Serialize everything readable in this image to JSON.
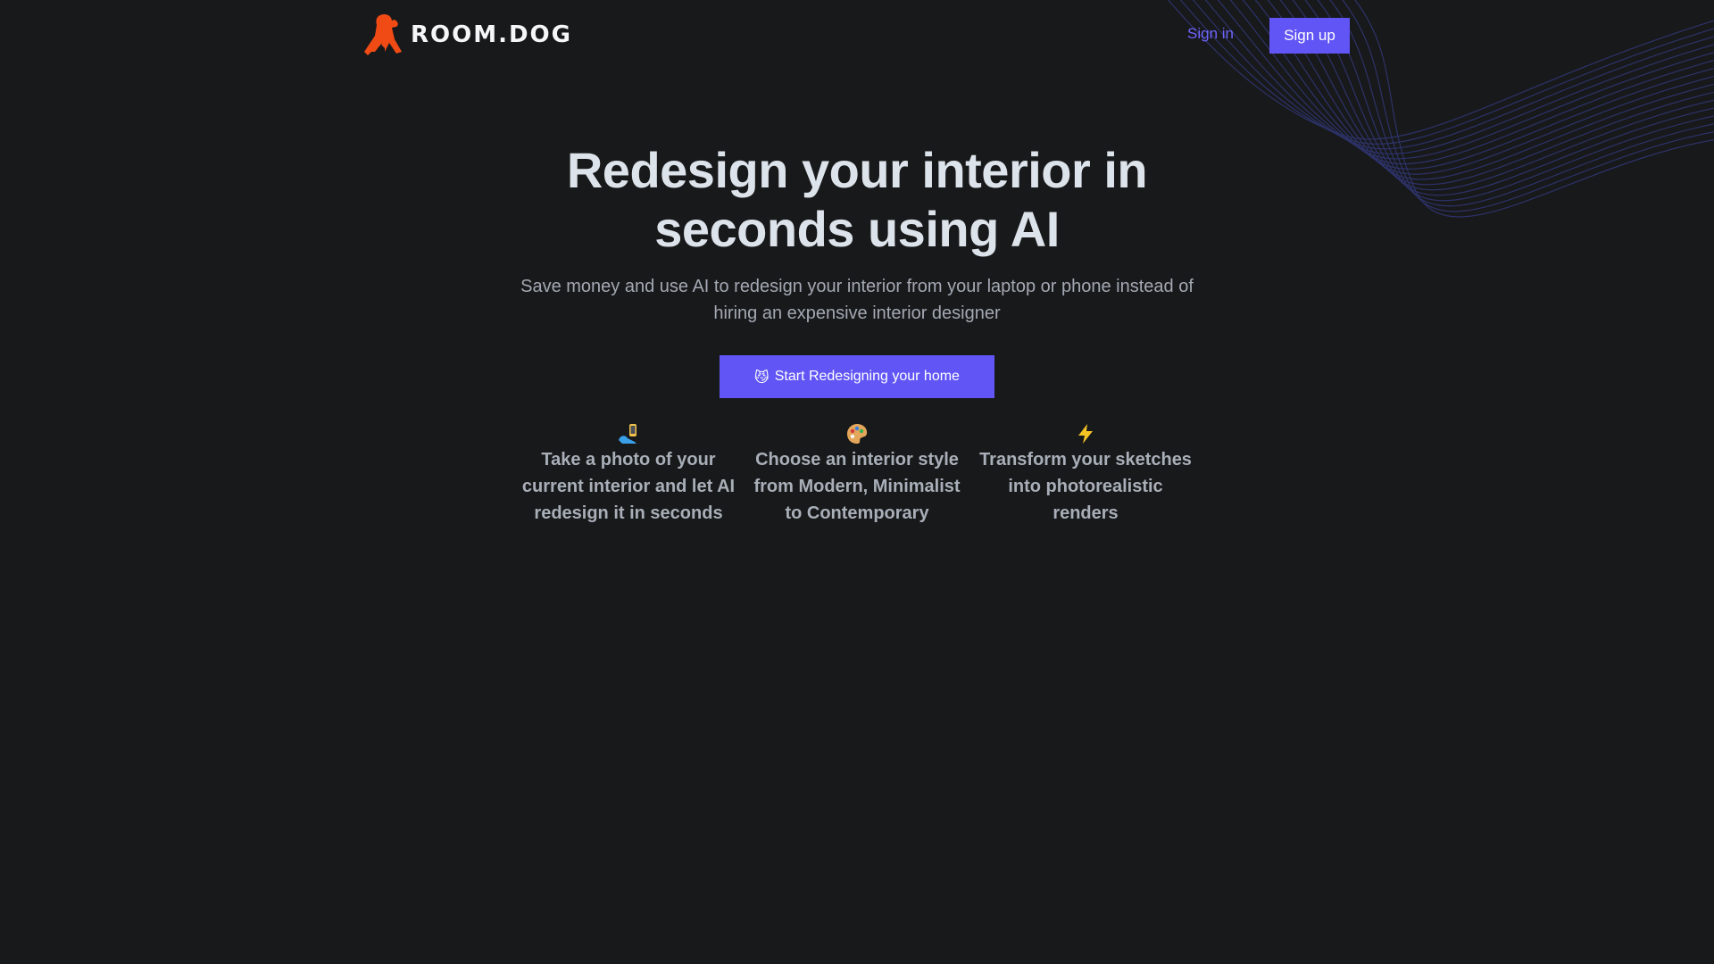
{
  "brand": {
    "name": "ROOM.DOG",
    "logo_icon": "dog-house-logo-icon",
    "logo_color": "#f04b15"
  },
  "nav": {
    "sign_in_label": "Sign in",
    "sign_up_label": "Sign up"
  },
  "hero": {
    "title": "Redesign your interior in seconds using AI",
    "subtitle": "Save money and use AI to redesign your interior from your laptop or phone instead of hiring an expensive interior designer",
    "cta_emoji": "😼",
    "cta_label": "Start Redesigning your home"
  },
  "features": [
    {
      "icon": "selfie-phone-icon",
      "text": "Take a photo of your current interior and let AI redesign it in seconds"
    },
    {
      "icon": "palette-icon",
      "text": "Choose an interior style from Modern, Minimalist to Contemporary"
    },
    {
      "icon": "lightning-icon",
      "text": "Transform your sketches into photorealistic renders"
    }
  ],
  "colors": {
    "background": "#18191b",
    "accent": "#6156f5",
    "link": "#6f66ff",
    "heading": "#dde3ea",
    "muted": "#a3a9b3"
  }
}
